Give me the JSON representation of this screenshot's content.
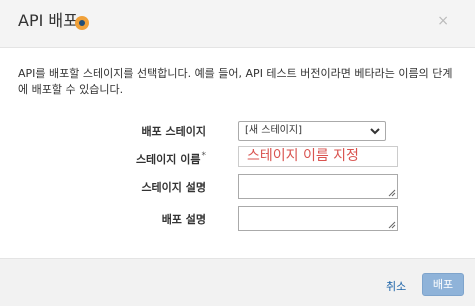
{
  "dialog": {
    "title": "API 배포",
    "description": "API를 배포할 스테이지를 선택합니다. 예를 들어, API 테스트 버전이라면 베타라는 이름의 단계에 배포할 수 있습니다."
  },
  "form": {
    "stage_label": "배포 스테이지",
    "stage_selected": "[새 스테이지]",
    "stage_name_label": "스테이지 이름",
    "stage_name_required_mark": "*",
    "stage_name_value": "스테이지 이름 지정",
    "stage_desc_label": "스테이지 설명",
    "deploy_desc_label": "배포 설명"
  },
  "footer": {
    "cancel_label": "취소",
    "deploy_label": "배포"
  },
  "icons": {
    "help": "help-icon",
    "close": "close-icon",
    "chevron": "chevron-down-icon"
  },
  "colors": {
    "accent": "#f0a13a",
    "link": "#1a62a8",
    "primary_button": "#8fb3d9",
    "input_text": "#d9534f"
  }
}
